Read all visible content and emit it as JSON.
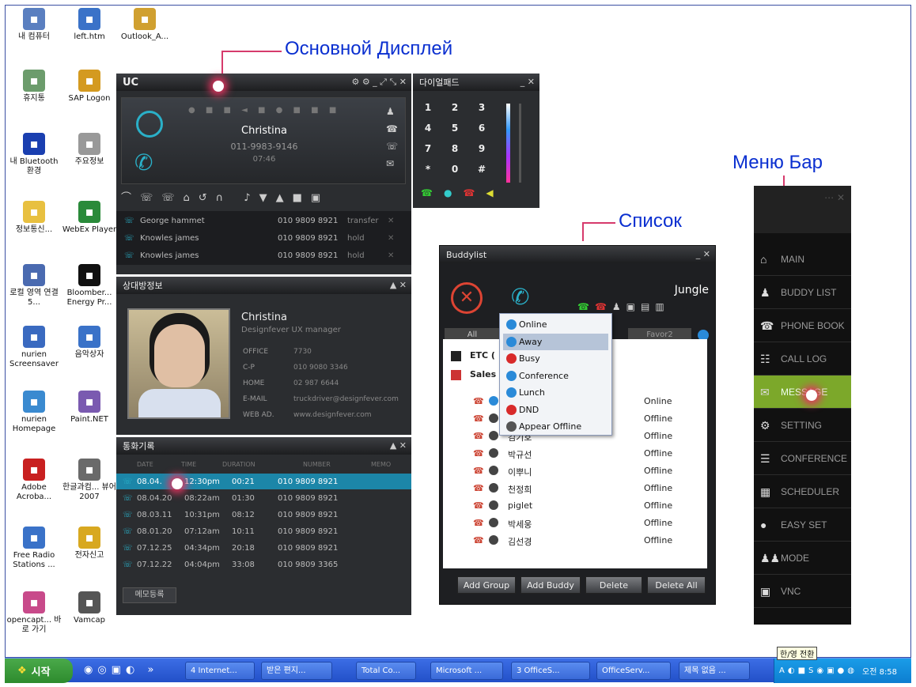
{
  "callouts": {
    "main": "Основной Дисплей",
    "list": "Список",
    "menu": "Меню Бар"
  },
  "desktop": [
    {
      "label": "내 컴퓨터",
      "icon": "computer-icon",
      "color": "#5a7fc0"
    },
    {
      "label": "left.htm",
      "icon": "ie-document-icon",
      "color": "#3a72c8"
    },
    {
      "label": "Outlook_A...",
      "icon": "outlook-icon",
      "color": "#d0a030"
    },
    {
      "label": "휴지통",
      "icon": "recycle-bin-icon",
      "color": "#6c9c6c"
    },
    {
      "label": "SAP Logon",
      "icon": "sap-icon",
      "color": "#d49a20"
    },
    {
      "label": "내 Bluetooth 환경",
      "icon": "bluetooth-icon",
      "color": "#1a3fb0"
    },
    {
      "label": "주요정보",
      "icon": "text-file-icon",
      "color": "#999"
    },
    {
      "label": "정보통신...",
      "icon": "folder-icon",
      "color": "#e8c040"
    },
    {
      "label": "WebEx Player",
      "icon": "webex-icon",
      "color": "#2a8a3a"
    },
    {
      "label": "로컬 영역 연결 5...",
      "icon": "network-icon",
      "color": "#4a6ab0"
    },
    {
      "label": "Bloomber... Energy Pr...",
      "icon": "bloomberg-icon",
      "color": "#111"
    },
    {
      "label": "nurien Screensaver",
      "icon": "screensaver-icon",
      "color": "#3a6ac0"
    },
    {
      "label": "음악상자",
      "icon": "ie-document-icon",
      "color": "#3a72c8"
    },
    {
      "label": "nurien Homepage",
      "icon": "homepage-icon",
      "color": "#3a8ad0"
    },
    {
      "label": "Paint.NET",
      "icon": "paint-icon",
      "color": "#7a5ab0"
    },
    {
      "label": "Adobe Acroba...",
      "icon": "acrobat-icon",
      "color": "#c82020"
    },
    {
      "label": "한글과컴... 뷰어 2007",
      "icon": "hancom-icon",
      "color": "#6a6a6a"
    },
    {
      "label": "Free Radio Stations ...",
      "icon": "ie-document-icon",
      "color": "#3a72c8"
    },
    {
      "label": "전자신고",
      "icon": "tax-icon",
      "color": "#d8a820"
    },
    {
      "label": "opencapt... 바로 가기",
      "icon": "gift-icon",
      "color": "#c84a8a"
    },
    {
      "label": "Vamcap",
      "icon": "vamcap-icon",
      "color": "#555"
    }
  ],
  "uc": {
    "title": "UC",
    "name": "Christina",
    "number": "011-9983-9146",
    "time": "07:46"
  },
  "dialpad": {
    "title": "다이얼패드",
    "keys": [
      "1",
      "2",
      "3",
      "4",
      "5",
      "6",
      "7",
      "8",
      "9",
      "*",
      "0",
      "#"
    ]
  },
  "calls": [
    {
      "name": "George hammet",
      "number": "010 9809 8921",
      "status": "transfer"
    },
    {
      "name": "Knowles james",
      "number": "010 9809 8921",
      "status": "hold"
    },
    {
      "name": "Knowles james",
      "number": "010 9809 8921",
      "status": "hold"
    }
  ],
  "contact": {
    "title": "상대방정보",
    "name": "Christina",
    "role": "Designfever UX manager",
    "fields": [
      {
        "k": "OFFICE",
        "v": "7730"
      },
      {
        "k": "C-P",
        "v": "010 9080 3346"
      },
      {
        "k": "HOME",
        "v": "02 987 6644"
      },
      {
        "k": "E-MAIL",
        "v": "truckdriver@designfever.com"
      },
      {
        "k": "WEB AD.",
        "v": "www.designfever.com"
      }
    ]
  },
  "history": {
    "title": "통화기록",
    "columns": [
      "DATE",
      "TIME",
      "DURATION",
      "NUMBER",
      "MEMO"
    ],
    "rows": [
      {
        "date": "08.04.",
        "time": "12:30pm",
        "dur": "00:21",
        "num": "010 9809 8921"
      },
      {
        "date": "08.04.20",
        "time": "08:22am",
        "dur": "01:30",
        "num": "010 9809 8921"
      },
      {
        "date": "08.03.11",
        "time": "10:31pm",
        "dur": "08:12",
        "num": "010 9809 8921"
      },
      {
        "date": "08.01.20",
        "time": "07:12am",
        "dur": "10:11",
        "num": "010 9809 8921"
      },
      {
        "date": "07.12.25",
        "time": "04:34pm",
        "dur": "20:18",
        "num": "010 9809 8921"
      },
      {
        "date": "07.12.22",
        "time": "04:04pm",
        "dur": "33:08",
        "num": "010 9809 3365"
      }
    ],
    "memo_button": "메모등록"
  },
  "buddy": {
    "title": "Buddylist",
    "user": "Jungle",
    "tabs": [
      "All",
      "Favor2"
    ],
    "groups": [
      "ETC (",
      "Sales"
    ],
    "rows": [
      {
        "name": "",
        "status": "Online"
      },
      {
        "name": "",
        "status": "Offline"
      },
      {
        "name": "김기호",
        "status": "Offline"
      },
      {
        "name": "박규선",
        "status": "Offline"
      },
      {
        "name": "이뿌니",
        "status": "Offline"
      },
      {
        "name": "천정희",
        "status": "Offline"
      },
      {
        "name": "piglet",
        "status": "Offline"
      },
      {
        "name": "박세웅",
        "status": "Offline"
      },
      {
        "name": "김선경",
        "status": "Offline"
      }
    ],
    "buttons": [
      "Add Group",
      "Add Buddy",
      "Delete",
      "Delete All"
    ]
  },
  "status_menu": [
    {
      "label": "Online",
      "color": "#2a8ad8"
    },
    {
      "label": "Away",
      "color": "#2a8ad8"
    },
    {
      "label": "Busy",
      "color": "#d82a2a"
    },
    {
      "label": "Conference",
      "color": "#2a8ad8"
    },
    {
      "label": "Lunch",
      "color": "#2a8ad8"
    },
    {
      "label": "DND",
      "color": "#d82a2a"
    },
    {
      "label": "Appear Offline",
      "color": "#555"
    }
  ],
  "sidebar": [
    "MAIN",
    "BUDDY LIST",
    "PHONE BOOK",
    "CALL LOG",
    "MESSAGE",
    "SETTING",
    "CONFERENCE",
    "SCHEDULER",
    "EASY SET",
    "MODE",
    "VNC"
  ],
  "taskbar": {
    "start": "시작",
    "items": [
      "4 Internet...",
      "받은 편지...",
      "Total Co...",
      "Microsoft ...",
      "3 OfficeS...",
      "OfficeServ...",
      "제목 없음 ..."
    ],
    "clock": "오전 8:58",
    "tooltip": "한/영 전환"
  }
}
